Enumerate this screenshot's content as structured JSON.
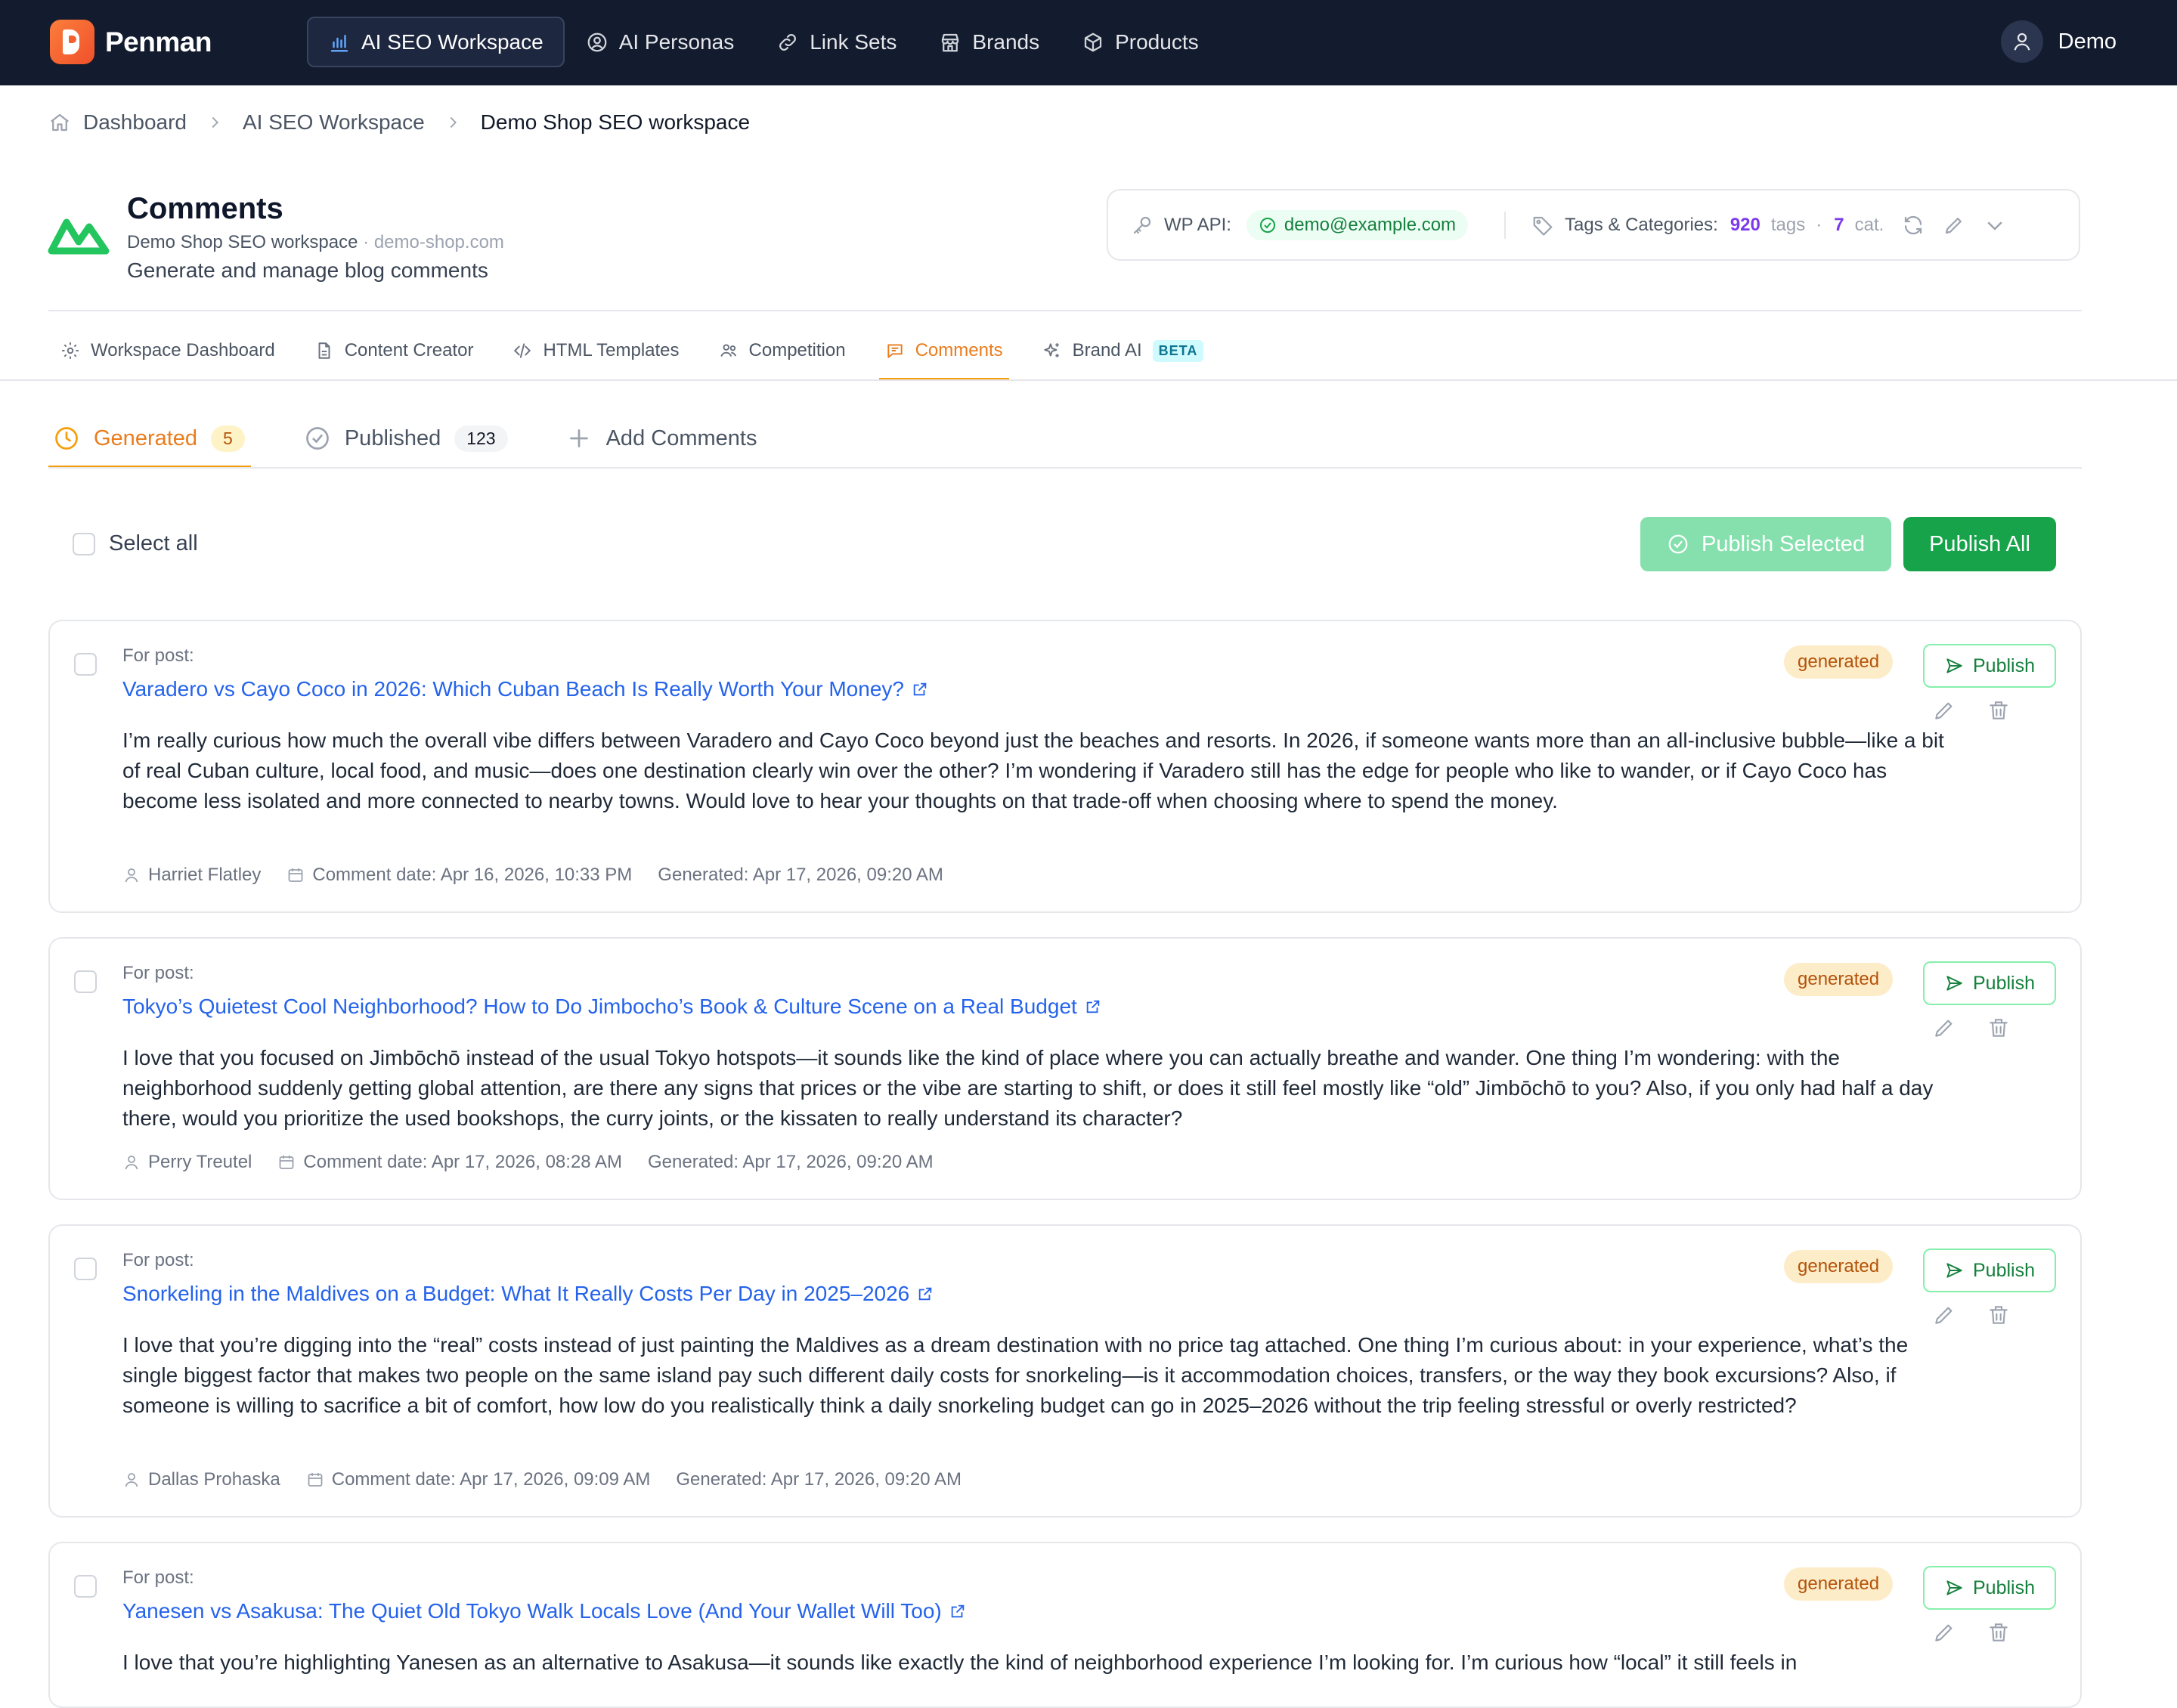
{
  "app": {
    "name": "Penman"
  },
  "nav": {
    "items": [
      {
        "label": "AI SEO Workspace",
        "icon": "bar-chart-icon",
        "active": true
      },
      {
        "label": "AI Personas",
        "icon": "user-circle-icon"
      },
      {
        "label": "Link Sets",
        "icon": "link-icon"
      },
      {
        "label": "Brands",
        "icon": "store-icon"
      },
      {
        "label": "Products",
        "icon": "box-icon"
      }
    ],
    "user": "Demo"
  },
  "breadcrumb": [
    "Dashboard",
    "AI SEO Workspace",
    "Demo Shop SEO workspace"
  ],
  "header": {
    "title": "Comments",
    "workspace": "Demo Shop SEO workspace",
    "separator": "·",
    "domain": "demo-shop.com",
    "description": "Generate and manage blog comments"
  },
  "info": {
    "wp_label": "WP API:",
    "wp_account": "demo@example.com",
    "tags_label": "Tags & Categories:",
    "tags_count": "920",
    "tags_unit": "tags",
    "dot": "·",
    "cat_count": "7",
    "cat_unit": "cat."
  },
  "subtabs": [
    {
      "label": "Workspace Dashboard"
    },
    {
      "label": "Content Creator"
    },
    {
      "label": "HTML Templates"
    },
    {
      "label": "Competition"
    },
    {
      "label": "Comments",
      "active": true
    },
    {
      "label": "Brand AI",
      "badge": "BETA"
    }
  ],
  "comment_tabs": {
    "generated": {
      "label": "Generated",
      "count": "5"
    },
    "published": {
      "label": "Published",
      "count": "123"
    },
    "add": {
      "label": "Add Comments"
    }
  },
  "actions": {
    "select_all": "Select all",
    "publish_selected": "Publish Selected",
    "publish_all": "Publish All"
  },
  "labels": {
    "for_post": "For post:",
    "status": "generated",
    "publish": "Publish"
  },
  "comments": [
    {
      "post_title": "Varadero vs Cayo Coco in 2026: Which Cuban Beach Is Really Worth Your Money?",
      "body": "I’m really curious how much the overall vibe differs between Varadero and Cayo Coco beyond just the beaches and resorts. In 2026, if someone wants more than an all-inclusive bubble—like a bit of real Cuban culture, local food, and music—does one destination clearly win over the other? I’m wondering if Varadero still has the edge for people who like to wander, or if Cayo Coco has become less isolated and more connected to nearby towns. Would love to hear your thoughts on that trade-off when choosing where to spend the money.",
      "author": "Harriet Flatley",
      "comment_date": "Comment date: Apr 16, 2026, 10:33 PM",
      "generated": "Generated: Apr 17, 2026, 09:20 AM"
    },
    {
      "post_title": "Tokyo’s Quietest Cool Neighborhood? How to Do Jimbocho’s Book & Culture Scene on a Real Budget",
      "body": "I love that you focused on Jimbōchō instead of the usual Tokyo hotspots—it sounds like the kind of place where you can actually breathe and wander. One thing I’m wondering: with the neighborhood suddenly getting global attention, are there any signs that prices or the vibe are starting to shift, or does it still feel mostly like “old” Jimbōchō to you? Also, if you only had half a day there, would you prioritize the used bookshops, the curry joints, or the kissaten to really understand its character?",
      "author": "Perry Treutel",
      "comment_date": "Comment date: Apr 17, 2026, 08:28 AM",
      "generated": "Generated: Apr 17, 2026, 09:20 AM"
    },
    {
      "post_title": "Snorkeling in the Maldives on a Budget: What It Really Costs Per Day in 2025–2026",
      "body": "I love that you’re digging into the “real” costs instead of just painting the Maldives as a dream destination with no price tag attached. One thing I’m curious about: in your experience, what’s the single biggest factor that makes two people on the same island pay such different daily costs for snorkeling—is it accommodation choices, transfers, or the way they book excursions? Also, if someone is willing to sacrifice a bit of comfort, how low do you realistically think a daily snorkeling budget can go in 2025–2026 without the trip feeling stressful or overly restricted?",
      "author": "Dallas Prohaska",
      "comment_date": "Comment date: Apr 17, 2026, 09:09 AM",
      "generated": "Generated: Apr 17, 2026, 09:20 AM"
    },
    {
      "post_title": "Yanesen vs Asakusa: The Quiet Old Tokyo Walk Locals Love (And Your Wallet Will Too)",
      "body": "I love that you’re highlighting Yanesen as an alternative to Asakusa—it sounds like exactly the kind of neighborhood experience I’m looking for. I’m curious how “local” it still feels in",
      "author": "",
      "comment_date": "",
      "generated": ""
    }
  ]
}
